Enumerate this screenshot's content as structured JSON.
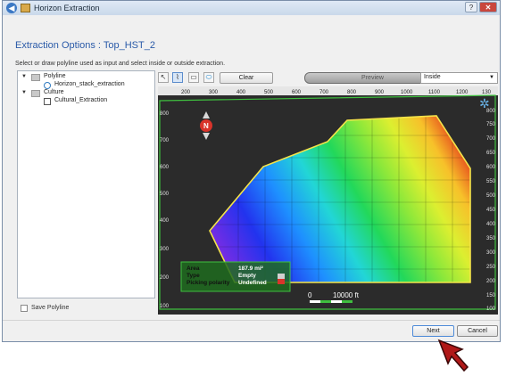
{
  "window": {
    "title": "Horizon Extraction",
    "help": "?",
    "close": "✕"
  },
  "heading": "Extraction Options : Top_HST_2",
  "instructions": "Select or draw polyline used as input and select inside or outside extraction.",
  "tree": {
    "groups": [
      {
        "label": "Polyline",
        "children": [
          "Horizon_stack_extraction"
        ]
      },
      {
        "label": "Culture",
        "children": [
          "Cultural_Extraction"
        ]
      }
    ]
  },
  "save_polyline": {
    "label": "Save Polyline",
    "checked": false
  },
  "toolbar": {
    "tools": [
      "pointer-icon",
      "polyline-icon",
      "rectangle-icon",
      "ellipse-icon"
    ],
    "clear_label": "Clear",
    "preview_label": "Preview",
    "extraction_mode": "Inside"
  },
  "map": {
    "top_ticks": [
      "200",
      "300",
      "400",
      "500",
      "600",
      "700",
      "800",
      "900",
      "1000",
      "1100",
      "1200",
      "130"
    ],
    "left_ticks": [
      "800",
      "700",
      "600",
      "500",
      "400",
      "300",
      "200",
      "100"
    ],
    "right_ticks": [
      "800",
      "750",
      "700",
      "650",
      "600",
      "550",
      "500",
      "450",
      "400",
      "350",
      "300",
      "250",
      "200",
      "150",
      "100"
    ],
    "compass": "N",
    "info_panel": {
      "rows": [
        {
          "label": "Area",
          "value": "187.9 mi²"
        },
        {
          "label": "Type",
          "value": "Empty"
        },
        {
          "label": "Picking polarity",
          "value": "Undefined"
        }
      ]
    },
    "scale_start": "0",
    "scale_end": "10000 ft",
    "colors": {
      "background": "#2b2b2b",
      "polygon_outline": "#f4e44a",
      "grid_frame": "#3fbf3f"
    }
  },
  "buttons": {
    "next": "Next",
    "cancel": "Cancel"
  }
}
